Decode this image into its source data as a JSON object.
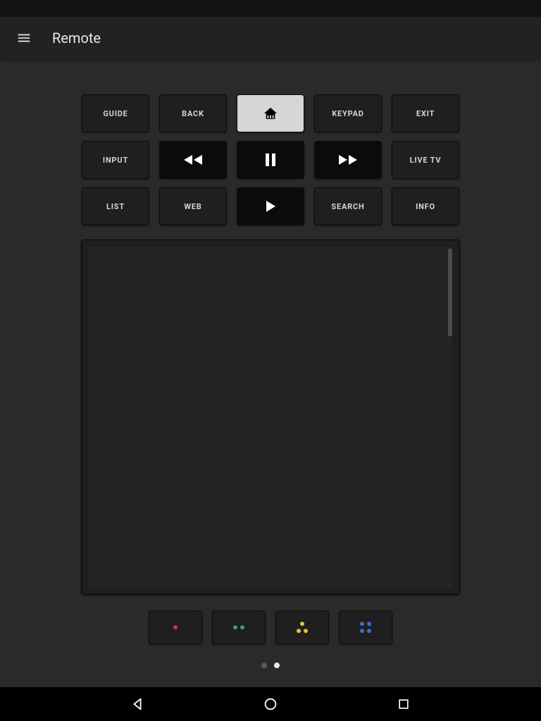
{
  "toolbar": {
    "title": "Remote"
  },
  "buttons": {
    "guide": "GUIDE",
    "back": "BACK",
    "keypad": "KEYPAD",
    "exit": "EXIT",
    "input": "INPUT",
    "livetv": "LIVE TV",
    "list": "LIST",
    "web": "WEB",
    "search": "SEARCH",
    "info": "INFO"
  },
  "colorButtons": {
    "red": "#d13a2e",
    "green": "#3aa35a",
    "yellow": "#e3c438",
    "blue": "#3a6fd1"
  },
  "pager": {
    "count": 2,
    "active": 1
  }
}
